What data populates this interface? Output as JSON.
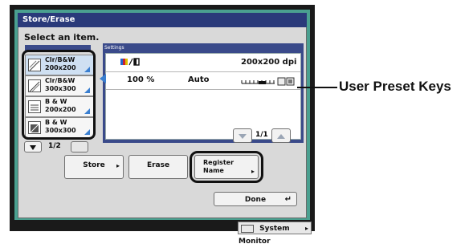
{
  "window": {
    "title": "Store/Erase"
  },
  "instruction": "Select an item.",
  "settings": {
    "header": "Settings",
    "resolution": "200x200 dpi",
    "zoom": "100 %",
    "density_mode": "Auto",
    "page_indicator": "1/1"
  },
  "presets": {
    "items": [
      {
        "label_line1": "Clr/B&W",
        "label_line2": "200x200",
        "selected": true
      },
      {
        "label_line1": "Clr/B&W",
        "label_line2": "300x300",
        "selected": false
      },
      {
        "label_line1": "B & W",
        "label_line2": "200x200",
        "selected": false
      },
      {
        "label_line1": "B & W",
        "label_line2": "300x300",
        "selected": false
      }
    ],
    "page_indicator": "1/2"
  },
  "actions": {
    "store_label": "Store",
    "erase_label": "Erase",
    "register_label_line1": "Register",
    "register_label_line2": "Name",
    "done_label": "Done"
  },
  "footer": {
    "system_monitor_label": "System Monitor"
  },
  "callout": {
    "text": "User Preset Keys"
  },
  "colors": {
    "accent": "#3a7fd0",
    "titlebar": "#2a3a7a",
    "screen_border": "#4aa090"
  }
}
